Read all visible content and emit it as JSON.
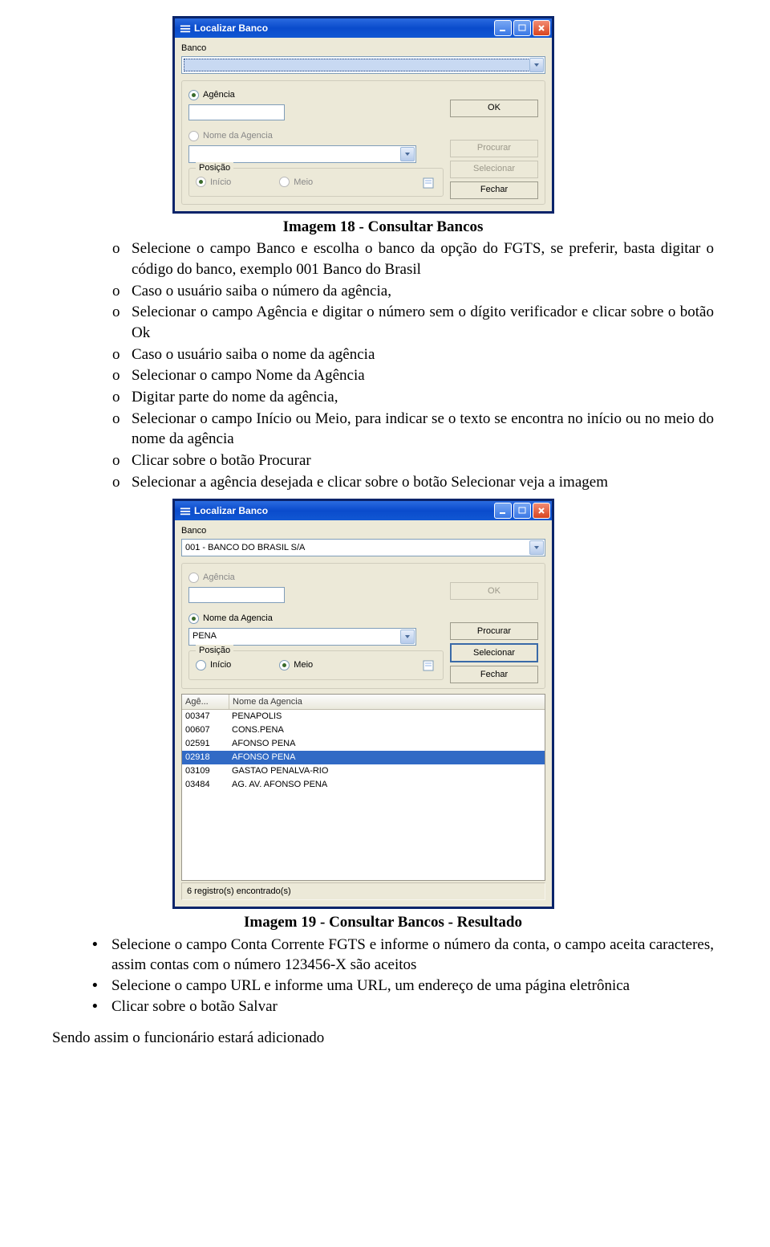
{
  "screenshot1": {
    "title": "Localizar Banco",
    "lbl_banco": "Banco",
    "combo_banco": "",
    "radio_agencia": "Agência",
    "agencia_value": "",
    "btn_ok": "OK",
    "radio_nome": "Nome da Agencia",
    "combo_nome": "",
    "btn_procurar": "Procurar",
    "btn_selecionar": "Selecionar",
    "posicao_legend": "Posição",
    "radio_inicio": "Início",
    "radio_meio": "Meio",
    "btn_fechar": "Fechar"
  },
  "caption1": "Imagem 18 - Consultar Bancos",
  "list1": [
    "Selecione o campo Banco e escolha o banco da opção do FGTS, se preferir, basta digitar o código do banco, exemplo 001 Banco do Brasil",
    "Caso o usuário saiba o número da agência,",
    "Selecionar o campo Agência e digitar o número sem o dígito verificador e clicar sobre o botão Ok",
    "Caso o usuário saiba o nome da agência",
    "Selecionar o campo Nome da Agência",
    "Digitar parte do nome da agência,",
    "Selecionar o campo Início ou Meio, para indicar se o texto se encontra no início ou no meio do nome da agência",
    "Clicar sobre o botão Procurar",
    "Selecionar a agência desejada e clicar sobre o botão Selecionar veja a imagem"
  ],
  "screenshot2": {
    "title": "Localizar Banco",
    "lbl_banco": "Banco",
    "combo_banco": "001 - BANCO DO BRASIL S/A",
    "radio_agencia": "Agência",
    "agencia_value": "",
    "btn_ok": "OK",
    "radio_nome": "Nome da Agencia",
    "combo_nome": "PENA",
    "btn_procurar": "Procurar",
    "btn_selecionar": "Selecionar",
    "posicao_legend": "Posição",
    "radio_inicio": "Início",
    "radio_meio": "Meio",
    "btn_fechar": "Fechar",
    "col_age": "Agê...",
    "col_nome": "Nome da Agencia",
    "rows": [
      {
        "code": "00347",
        "name": "PENAPOLIS"
      },
      {
        "code": "00607",
        "name": "CONS.PENA"
      },
      {
        "code": "02591",
        "name": "AFONSO PENA"
      },
      {
        "code": "02918",
        "name": "AFONSO PENA"
      },
      {
        "code": "03109",
        "name": "GASTAO PENALVA-RIO"
      },
      {
        "code": "03484",
        "name": "AG. AV. AFONSO PENA"
      }
    ],
    "status": "6 registro(s) encontrado(s)"
  },
  "caption2": "Imagem 19 - Consultar Bancos - Resultado",
  "list2": [
    "Selecione o campo Conta Corrente FGTS e informe o número da conta, o campo aceita caracteres, assim contas com o número 123456-X são aceitos",
    "Selecione o campo URL e informe uma URL, um endereço de uma página eletrônica",
    "Clicar sobre o botão Salvar"
  ],
  "lastline": "Sendo assim o funcionário estará adicionado"
}
